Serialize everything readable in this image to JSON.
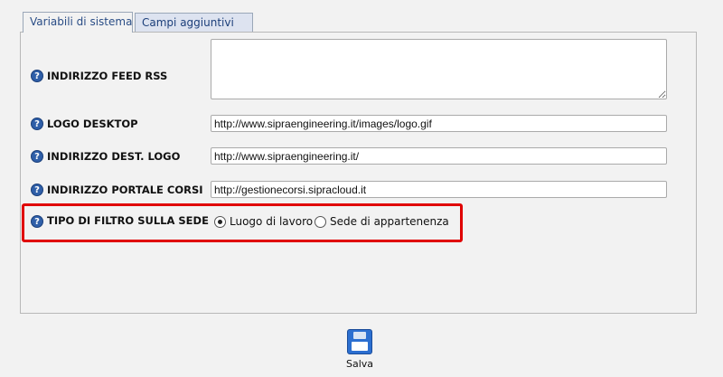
{
  "tabs": [
    {
      "label": "Variabili di sistema"
    },
    {
      "label": "Campi aggiuntivi"
    }
  ],
  "fields": {
    "feed_rss": {
      "label": "INDIRIZZO FEED RSS",
      "value": ""
    },
    "logo_desktop": {
      "label": "LOGO DESKTOP",
      "value": "http://www.sipraengineering.it/images/logo.gif"
    },
    "dest_logo": {
      "label": "INDIRIZZO DEST. LOGO",
      "value": "http://www.sipraengineering.it/"
    },
    "portale_corsi": {
      "label": "INDIRIZZO PORTALE CORSI",
      "value": "http://gestionecorsi.sipracloud.it"
    },
    "filtro_sede": {
      "label": "TIPO DI FILTRO SULLA SEDE",
      "options": [
        {
          "label": "Luogo di lavoro",
          "checked": true
        },
        {
          "label": "Sede di appartenenza",
          "checked": false
        }
      ]
    }
  },
  "help_icon": "?",
  "save": {
    "label": "Salva",
    "icon": "floppy-disk-icon"
  },
  "colors": {
    "highlight": "#e00000",
    "help_icon": "#2f5fa8",
    "save_icon": "#2c6fd0"
  }
}
